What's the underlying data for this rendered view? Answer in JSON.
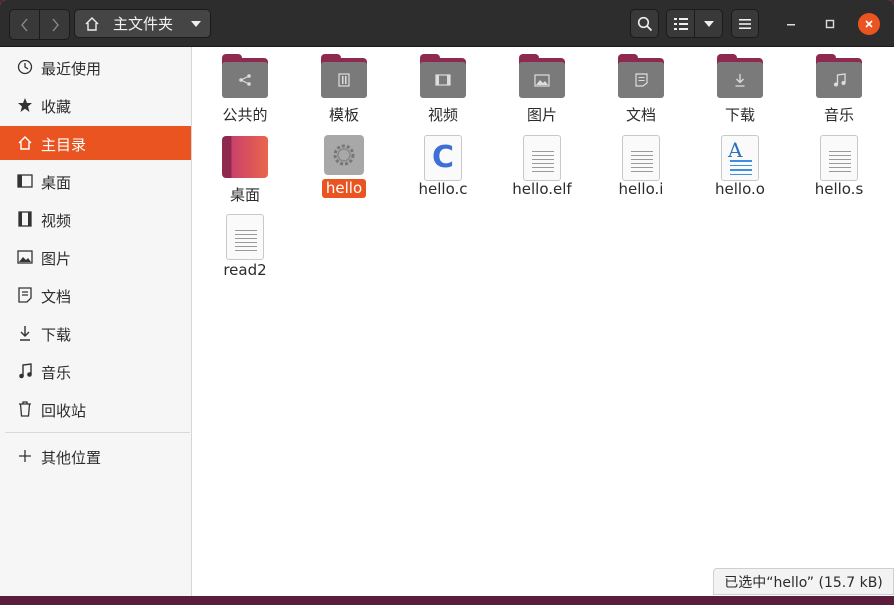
{
  "header": {
    "back_icon": "chevron-left-icon",
    "forward_icon": "chevron-right-icon",
    "path_label": "主文件夹"
  },
  "sidebar": {
    "items": [
      {
        "label": "最近使用",
        "icon": "clock-icon"
      },
      {
        "label": "收藏",
        "icon": "star-icon"
      },
      {
        "label": "主目录",
        "icon": "home-icon",
        "active": true
      },
      {
        "label": "桌面",
        "icon": "desktop-icon"
      },
      {
        "label": "视频",
        "icon": "film-icon"
      },
      {
        "label": "图片",
        "icon": "image-icon"
      },
      {
        "label": "文档",
        "icon": "document-icon"
      },
      {
        "label": "下载",
        "icon": "download-icon"
      },
      {
        "label": "音乐",
        "icon": "music-icon"
      },
      {
        "label": "回收站",
        "icon": "trash-icon"
      },
      {
        "label": "其他位置",
        "icon": "plus-icon"
      }
    ]
  },
  "files": [
    {
      "name": "公共的",
      "type": "folder",
      "icon": "share-icon"
    },
    {
      "name": "模板",
      "type": "folder",
      "icon": "template-icon"
    },
    {
      "name": "视频",
      "type": "folder",
      "icon": "film-icon"
    },
    {
      "name": "图片",
      "type": "folder",
      "icon": "image-icon"
    },
    {
      "name": "文档",
      "type": "folder",
      "icon": "document-icon"
    },
    {
      "name": "下载",
      "type": "folder",
      "icon": "download-icon"
    },
    {
      "name": "音乐",
      "type": "folder",
      "icon": "music-icon"
    },
    {
      "name": "桌面",
      "type": "desktop-folder",
      "icon": "desktop-folder-icon"
    },
    {
      "name": "hello",
      "type": "executable",
      "icon": "gear-icon",
      "selected": true
    },
    {
      "name": "hello.c",
      "type": "c-source",
      "icon": "c-source-icon",
      "glyph": "C"
    },
    {
      "name": "hello.elf",
      "type": "text",
      "icon": "text-file-icon"
    },
    {
      "name": "hello.i",
      "type": "text",
      "icon": "text-file-icon"
    },
    {
      "name": "hello.o",
      "type": "object",
      "icon": "object-file-icon",
      "glyph": "A"
    },
    {
      "name": "hello.s",
      "type": "text",
      "icon": "text-file-icon"
    },
    {
      "name": "read2",
      "type": "text",
      "icon": "text-file-icon"
    }
  ],
  "status": {
    "text": "已选中“hello” (15.7 kB)"
  },
  "colors": {
    "accent": "#e95420",
    "folder_tab": "#8e2a4f",
    "folder_body": "#7a7a7a",
    "headerbar": "#2d2d2d"
  }
}
